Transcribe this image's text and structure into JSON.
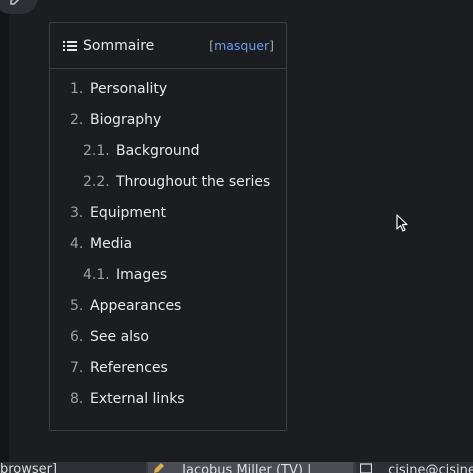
{
  "toc": {
    "title": "Sommaire",
    "toggle_open": "[",
    "toggle_label": "masquer",
    "toggle_close": "]",
    "items": [
      {
        "num": "1.",
        "label": "Personality",
        "level": 1
      },
      {
        "num": "2.",
        "label": "Biography",
        "level": 1
      },
      {
        "num": "2.1.",
        "label": "Background",
        "level": 2
      },
      {
        "num": "2.2.",
        "label": "Throughout the series",
        "level": 2
      },
      {
        "num": "3.",
        "label": "Equipment",
        "level": 1
      },
      {
        "num": "4.",
        "label": "Media",
        "level": 1
      },
      {
        "num": "4.1.",
        "label": "Images",
        "level": 2
      },
      {
        "num": "5.",
        "label": "Appearances",
        "level": 1
      },
      {
        "num": "6.",
        "label": "See also",
        "level": 1
      },
      {
        "num": "7.",
        "label": "References",
        "level": 1
      },
      {
        "num": "8.",
        "label": "External links",
        "level": 1
      }
    ]
  },
  "taskbar": {
    "tasks": [
      {
        "label": "browser]",
        "icon": "browser-window-icon"
      },
      {
        "label": "Jacobus Miller (TV) |",
        "icon": "pencil-icon"
      },
      {
        "label": "cjsine@cjsine",
        "icon": "terminal-icon"
      }
    ]
  },
  "icons": {
    "top_button": "edit-icon",
    "toc": "list-icon",
    "cursor": "mouse-pointer-icon"
  },
  "colors": {
    "background": "#1b1d21",
    "link": "#6d9bef",
    "text": "#e6e8eb",
    "number": "#9aa0a7",
    "border": "#3a3e45"
  }
}
